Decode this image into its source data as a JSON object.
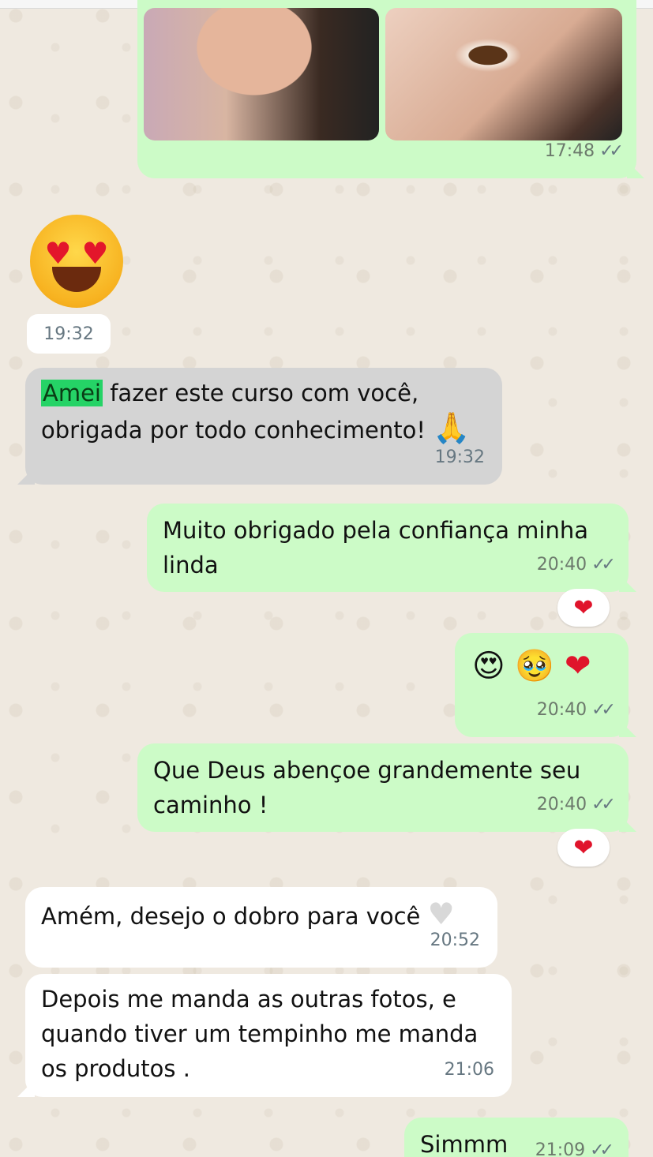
{
  "messages": {
    "photos": {
      "time": "17:48",
      "ticks": "✓✓"
    },
    "sticker": {
      "time": "19:32"
    },
    "thanks": {
      "highlight": "Amei",
      "line1_rest": " fazer este curso com você,",
      "line2": "obrigada por todo conhecimento!",
      "emoji": "🙏",
      "time": "19:32"
    },
    "reply1": {
      "text": "Muito obrigado pela confiança minha linda",
      "time": "20:40",
      "ticks": "✓✓",
      "reaction": "❤"
    },
    "emojis": {
      "emoji1": "😍",
      "emoji2": "🥹",
      "emoji3": "❤",
      "time": "20:40",
      "ticks": "✓✓"
    },
    "blessing": {
      "text": "Que Deus abençoe  grandemente seu caminho !",
      "time": "20:40",
      "ticks": "✓✓",
      "reaction": "❤"
    },
    "amen": {
      "text": "Amém, desejo o dobro para você",
      "emoji": "♥",
      "time": "20:52"
    },
    "request": {
      "text": "Depois me manda as outras fotos, e quando tiver um tempinho me manda os produtos .",
      "time": "21:06"
    },
    "last": {
      "text": "Simmm",
      "time": "21:09",
      "ticks": "✓✓"
    }
  },
  "colors": {
    "outgoing": "#d9fdd3",
    "incoming": "#ffffff",
    "incoming_grey": "#d4d4d4",
    "highlight": "#25d366",
    "heart": "#e0142b"
  }
}
